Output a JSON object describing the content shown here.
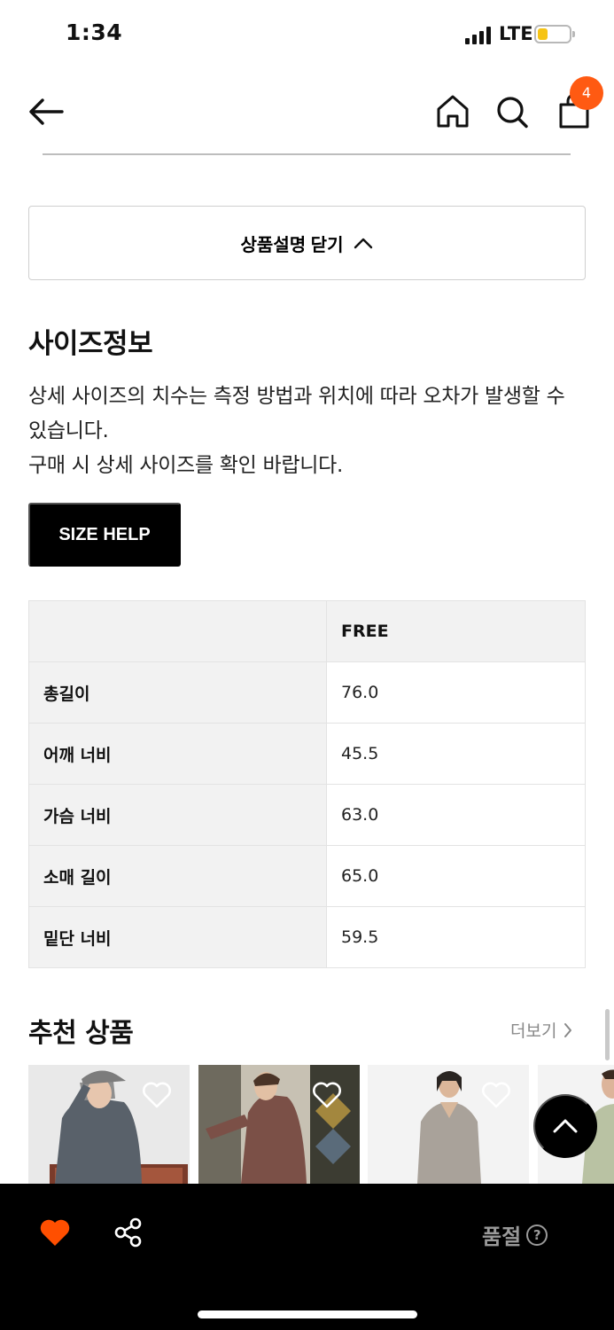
{
  "status_bar": {
    "time": "1:34",
    "network": "LTE"
  },
  "nav": {
    "icons": [
      "back-arrow-icon",
      "home-icon",
      "search-icon",
      "shopping-bag-icon"
    ],
    "cart_count": "4",
    "badge_color": "#ff5a12"
  },
  "description_toggle": {
    "label": "상품설명 닫기",
    "icon": "chevron-up-icon"
  },
  "size_info": {
    "title": "사이즈정보",
    "lines": [
      "상세 사이즈의 치수는 측정 방법과 위치에 따라 오차가 발생할 수 있습니다.",
      "구매 시 상세 사이즈를 확인 바랍니다."
    ],
    "help_button": "SIZE HELP",
    "table": {
      "header": [
        "",
        "FREE"
      ],
      "rows": [
        {
          "label": "총길이",
          "value": "76.0"
        },
        {
          "label": "어깨 너비",
          "value": "45.5"
        },
        {
          "label": "가슴 너비",
          "value": "63.0"
        },
        {
          "label": "소매 길이",
          "value": "65.0"
        },
        {
          "label": "밑단 너비",
          "value": "59.5"
        }
      ]
    }
  },
  "recommended": {
    "title": "추천 상품",
    "more_label": "더보기",
    "products": [
      {
        "icon": "heart-outline-icon"
      },
      {
        "icon": "heart-outline-icon"
      },
      {
        "icon": "heart-outline-icon"
      },
      {
        "icon": "heart-outline-icon"
      }
    ]
  },
  "bottom_bar": {
    "like_icon": "heart-filled-icon",
    "like_color": "#ff4f00",
    "share_icon": "share-icon",
    "status_label": "품절",
    "help_icon": "question-circle-icon",
    "help_glyph": "?"
  }
}
